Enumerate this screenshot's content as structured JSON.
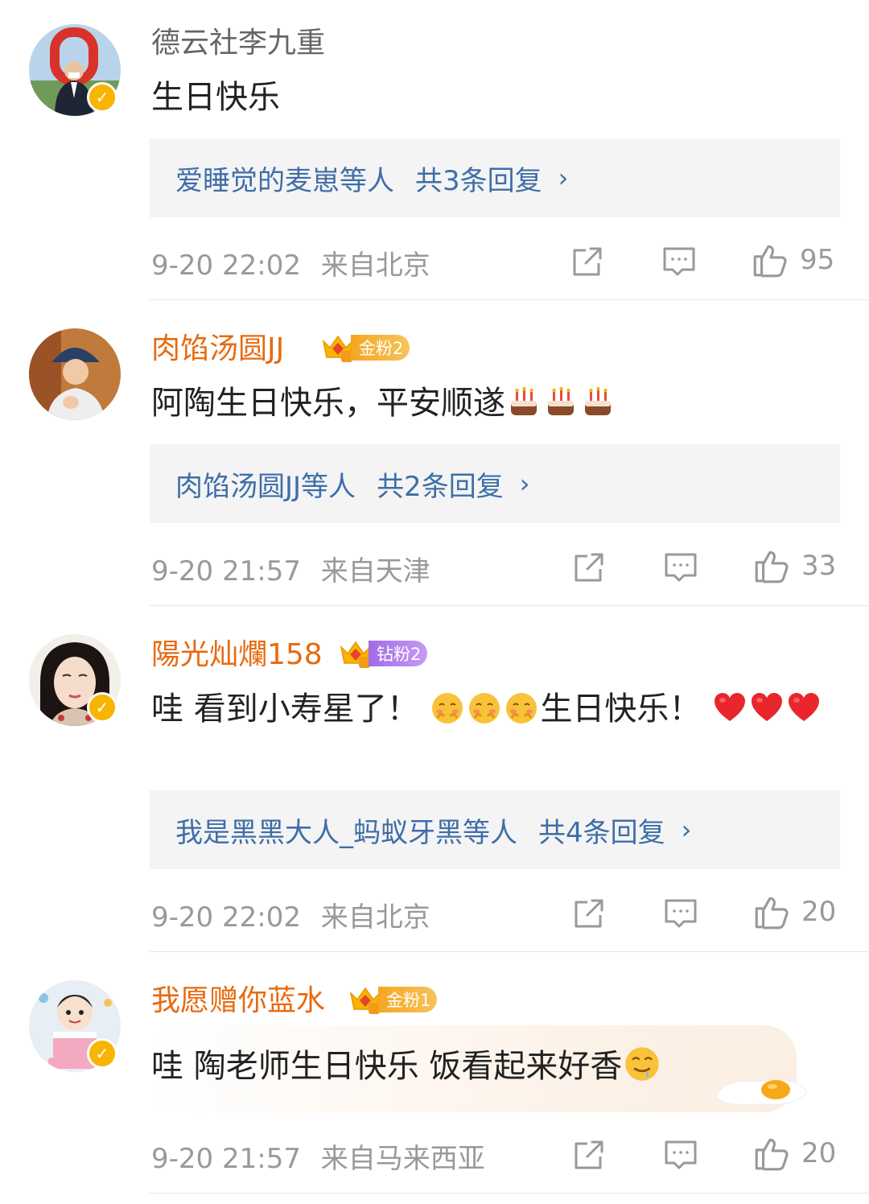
{
  "comments": [
    {
      "name": "德云社李九重",
      "text": "生日快乐",
      "replies_users": "爱睡觉的麦崽等人",
      "replies_count": "共3条回复",
      "time": "9-20 22:02",
      "location": "来自北京",
      "likes": "95",
      "verified": true
    },
    {
      "name": "肉馅汤圆JJ",
      "badge": "金粉2",
      "text": "阿陶生日快乐，平安顺遂",
      "emojis": [
        "cake-icon",
        "cake-icon",
        "cake-icon"
      ],
      "replies_users": "肉馅汤圆JJ等人",
      "replies_count": "共2条回复",
      "time": "9-20 21:57",
      "location": "来自天津",
      "likes": "33"
    },
    {
      "name": "陽光灿爛158",
      "badge": "钻粉2",
      "text_a": "哇 看到小寿星了！",
      "text_b": "生日快乐！",
      "emojis": [
        "shy-face-icon",
        "heart-icon"
      ],
      "replies_users": "我是黑黑大人_蚂蚁牙黑等人",
      "replies_count": "共4条回复",
      "time": "9-20 22:02",
      "location": "来自北京",
      "likes": "20",
      "verified": true
    },
    {
      "name": "我愿赠你蓝水",
      "badge": "金粉1",
      "text": "哇 陶老师生日快乐 饭看起来好香",
      "emojis": [
        "drool-face-icon",
        "fried-egg-icon"
      ],
      "time": "9-20 21:57",
      "location": "来自马来西亚",
      "likes": "20",
      "verified": true
    }
  ],
  "colors": {
    "name_plain": "#666666",
    "name_fan": "#e86a10",
    "reply_link": "#3e6ea8",
    "meta": "#999999",
    "verified": "#f7b500",
    "gold_badge": "#f5a623",
    "diamond_badge": "#a06ce8"
  }
}
